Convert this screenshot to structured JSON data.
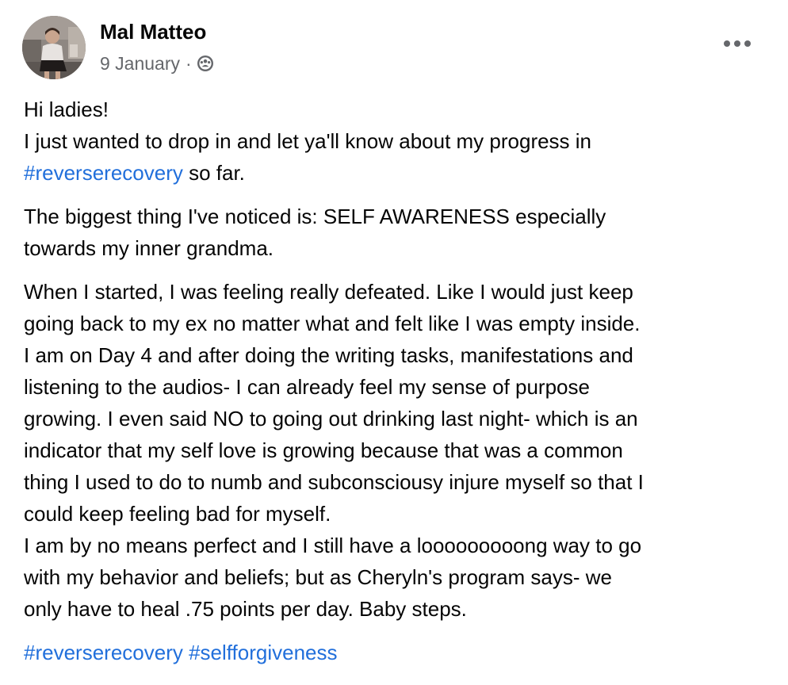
{
  "post": {
    "author": "Mal Matteo",
    "date": "9 January",
    "separator": "·",
    "audience_icon": "group-audience-icon",
    "more_icon": "more-options-icon"
  },
  "content": {
    "p1": {
      "l1": "Hi ladies!",
      "l2": "I just wanted to drop in and let ya'll know about my progress in",
      "l3_tag": "#reverserecovery",
      "l3_text": " so far."
    },
    "p2": {
      "l1": "The biggest thing I've noticed is: SELF AWARENESS especially",
      "l2": "towards my inner grandma."
    },
    "p3": {
      "l1": "When I started, I was feeling really defeated. Like I would just keep",
      "l2": "going back to my ex no matter what and felt like I was empty inside.",
      "l3": "I am on Day 4 and after doing the writing tasks, manifestations and",
      "l4": "listening to the audios- I can already feel my sense of purpose",
      "l5": "growing. I even said NO to going out drinking last night- which is an",
      "l6": "indicator that my self love is growing because that was a common",
      "l7": "thing I used to do to numb and subconsciousy injure myself so that I",
      "l8": "could keep feeling bad for myself.",
      "l9": "I am by no means perfect and I still have a looooooooong way to go",
      "l10": "with my behavior and beliefs;  but as Cheryln's program says- we",
      "l11": "only have to heal .75 points per day. Baby steps."
    },
    "p4": {
      "tag1": "#reverserecovery",
      "tag2": "#selfforgiveness"
    }
  },
  "colors": {
    "text": "#050505",
    "secondary": "#65676b",
    "link": "#216fdb"
  }
}
